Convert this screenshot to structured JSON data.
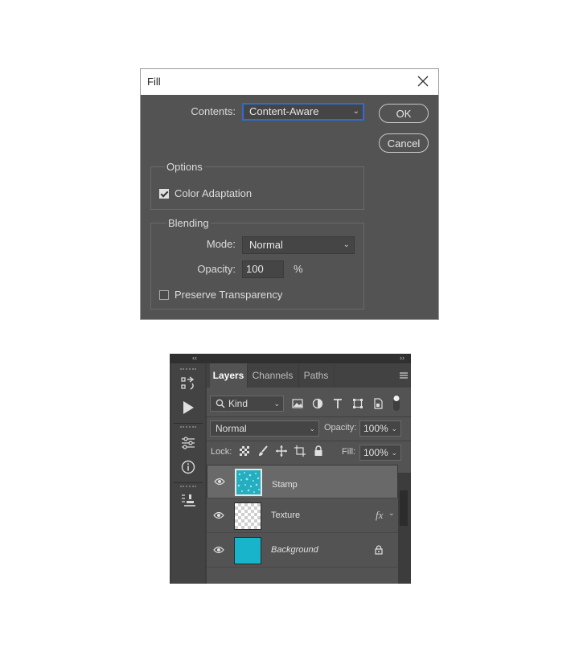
{
  "fill_dialog": {
    "title": "Fill",
    "contents_label": "Contents:",
    "contents_value": "Content-Aware",
    "ok_label": "OK",
    "cancel_label": "Cancel",
    "options_title": "Options",
    "color_adaptation_label": "Color Adaptation",
    "color_adaptation_checked": true,
    "blending_title": "Blending",
    "mode_label": "Mode:",
    "mode_value": "Normal",
    "opacity_label": "Opacity:",
    "opacity_value": "100",
    "opacity_unit": "%",
    "preserve_transparency_label": "Preserve Transparency",
    "preserve_transparency_checked": false
  },
  "collapse": {
    "left": "‹‹",
    "right": "››"
  },
  "layers_panel": {
    "tabs": [
      {
        "label": "Layers",
        "active": true
      },
      {
        "label": "Channels",
        "active": false
      },
      {
        "label": "Paths",
        "active": false
      }
    ],
    "filter_kind": "Kind",
    "blend_mode": "Normal",
    "opacity_label": "Opacity:",
    "opacity_value": "100%",
    "lock_label": "Lock:",
    "fill_label": "Fill:",
    "fill_value": "100%",
    "fx_label": "fx",
    "layers": [
      {
        "name": "Stamp",
        "selected": true,
        "thumb": "stamp-texture",
        "italic": false
      },
      {
        "name": "Texture",
        "selected": false,
        "thumb": "transparent",
        "italic": false,
        "has_fx": true
      },
      {
        "name": "Background",
        "selected": false,
        "thumb": "solid-cyan",
        "italic": true,
        "locked": true
      }
    ]
  },
  "colors": {
    "dialog_bg": "#535353",
    "focus_blue": "#2f6bd1",
    "cyan": "#18b4cc"
  }
}
